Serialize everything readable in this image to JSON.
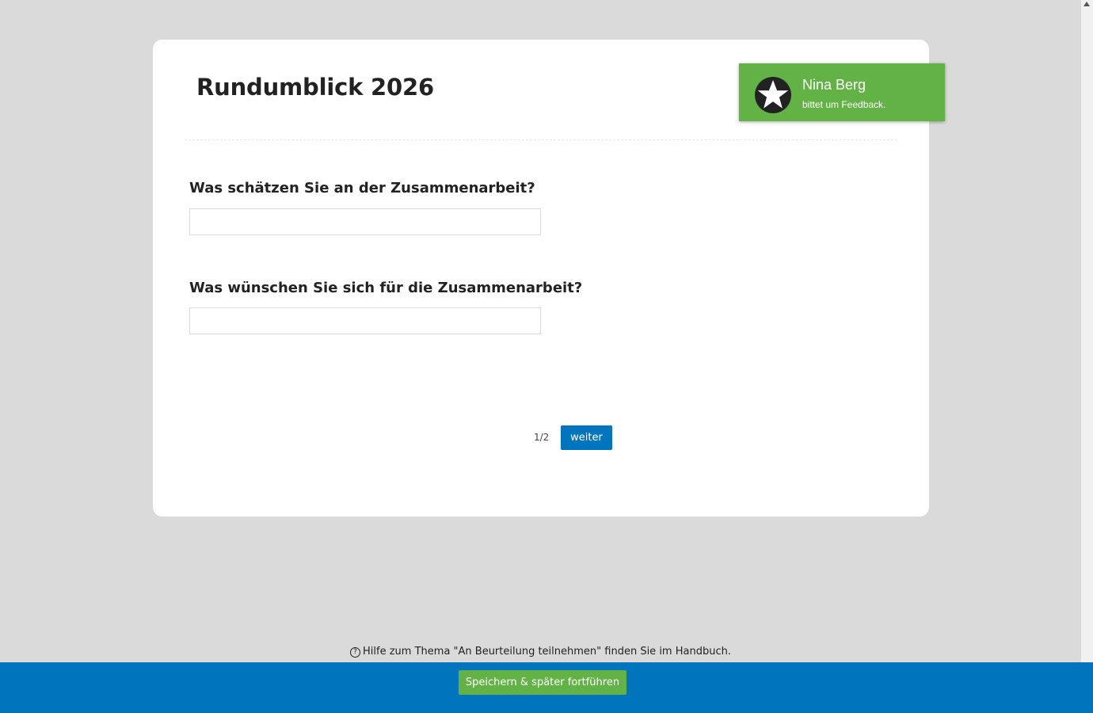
{
  "survey": {
    "title": "Rundumblick 2026",
    "questions": [
      {
        "label": "Was schätzen Sie an der Zusammenarbeit?",
        "value": ""
      },
      {
        "label": "Was wünschen Sie sich für die Zusammenarbeit?",
        "value": ""
      }
    ],
    "pager": "1/2",
    "next_label": "weiter"
  },
  "notification": {
    "name": "Nina Berg",
    "message": "bittet um Feedback.",
    "icon": "star-icon",
    "color": "#62b245"
  },
  "help": {
    "icon": "question-circle-icon",
    "text": "Hilfe zum Thema \"An Beurteilung teilnehmen\" finden Sie im Handbuch."
  },
  "footer": {
    "save_label": "Speichern & später fortführen",
    "bar_color": "#0075be"
  }
}
